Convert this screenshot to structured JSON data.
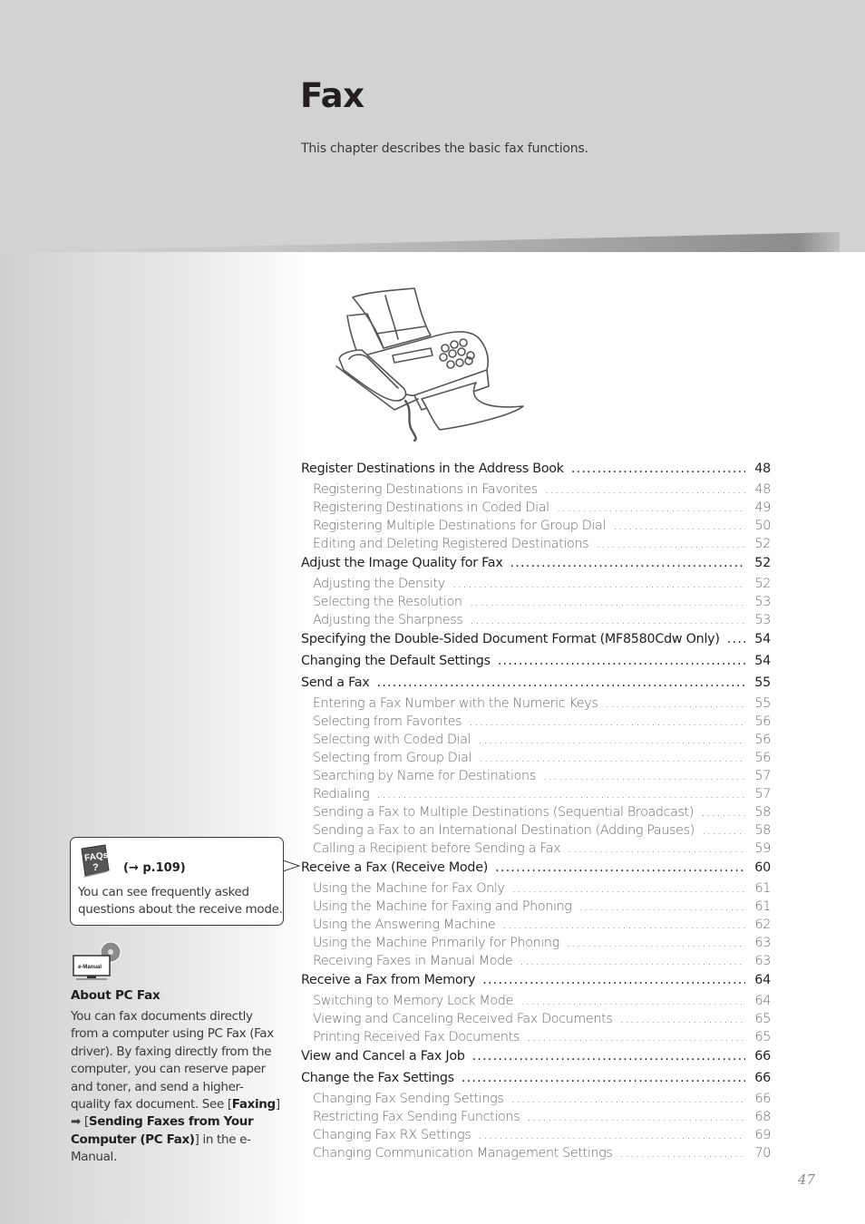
{
  "header": {
    "title": "Fax",
    "subtitle": "This chapter describes the basic fax functions."
  },
  "illustration": {
    "icon": "fax-machine-illustration"
  },
  "toc": [
    {
      "level": "main",
      "label": "Register Destinations in the Address Book",
      "page": "48"
    },
    {
      "level": "sub",
      "label": "Registering Destinations in Favorites",
      "page": "48"
    },
    {
      "level": "sub",
      "label": "Registering Destinations in Coded Dial",
      "page": "49"
    },
    {
      "level": "sub",
      "label": "Registering Multiple Destinations for Group Dial",
      "page": "50"
    },
    {
      "level": "sub",
      "label": "Editing and Deleting Registered Destinations",
      "page": "52"
    },
    {
      "level": "main",
      "label": "Adjust the Image Quality for Fax",
      "page": "52"
    },
    {
      "level": "sub",
      "label": "Adjusting the Density",
      "page": "52"
    },
    {
      "level": "sub",
      "label": "Selecting the Resolution",
      "page": "53"
    },
    {
      "level": "sub",
      "label": "Adjusting the Sharpness",
      "page": "53"
    },
    {
      "level": "main",
      "label": "Specifying the Double-Sided Document Format (MF8580Cdw Only)",
      "page": "54"
    },
    {
      "level": "main",
      "label": "Changing the Default Settings",
      "page": "54"
    },
    {
      "level": "main",
      "label": "Send a Fax",
      "page": "55"
    },
    {
      "level": "sub",
      "label": "Entering a Fax Number with the Numeric Keys",
      "page": "55"
    },
    {
      "level": "sub",
      "label": "Selecting from Favorites",
      "page": "56"
    },
    {
      "level": "sub",
      "label": "Selecting with Coded Dial",
      "page": "56"
    },
    {
      "level": "sub",
      "label": "Selecting from Group Dial",
      "page": "56"
    },
    {
      "level": "sub",
      "label": "Searching by Name for Destinations",
      "page": "57"
    },
    {
      "level": "sub",
      "label": "Redialing",
      "page": "57"
    },
    {
      "level": "sub",
      "label": "Sending a Fax to Multiple Destinations (Sequential Broadcast)",
      "page": "58"
    },
    {
      "level": "sub",
      "label": "Sending a Fax to an International Destination (Adding Pauses)",
      "page": "58"
    },
    {
      "level": "sub",
      "label": "Calling a Recipient before Sending a Fax",
      "page": "59"
    },
    {
      "level": "main",
      "label": "Receive a Fax (Receive Mode)",
      "page": "60"
    },
    {
      "level": "sub",
      "label": "Using the Machine for Fax Only",
      "page": "61"
    },
    {
      "level": "sub",
      "label": "Using the Machine for Faxing and Phoning",
      "page": "61"
    },
    {
      "level": "sub",
      "label": "Using the Answering Machine",
      "page": "62"
    },
    {
      "level": "sub",
      "label": "Using the Machine Primarily for Phoning",
      "page": "63"
    },
    {
      "level": "sub",
      "label": "Receiving Faxes in Manual Mode",
      "page": "63"
    },
    {
      "level": "main",
      "label": "Receive a Fax from Memory",
      "page": "64"
    },
    {
      "level": "sub",
      "label": "Switching to Memory Lock Mode",
      "page": "64"
    },
    {
      "level": "sub",
      "label": "Viewing and Canceling Received Fax Documents",
      "page": "65"
    },
    {
      "level": "sub",
      "label": "Printing Received Fax Documents",
      "page": "65"
    },
    {
      "level": "main",
      "label": "View and Cancel a Fax Job",
      "page": "66"
    },
    {
      "level": "main",
      "label": "Change the Fax Settings",
      "page": "66"
    },
    {
      "level": "sub",
      "label": "Changing Fax Sending Settings",
      "page": "66"
    },
    {
      "level": "sub",
      "label": "Restricting Fax Sending Functions",
      "page": "68"
    },
    {
      "level": "sub",
      "label": "Changing Fax RX Settings",
      "page": "69"
    },
    {
      "level": "sub",
      "label": "Changing Communication Management Settings",
      "page": "70"
    }
  ],
  "faq": {
    "icon_label_top": "FAQs",
    "icon_label_bottom": "?",
    "link": "(→ p.109)",
    "text": "You can see frequently asked questions about the receive mode."
  },
  "about_pc_fax": {
    "icon_label": "e-Manual",
    "title": "About PC Fax",
    "text_before": "You can fax documents directly from a computer using PC Fax (Fax driver). By faxing directly from the computer, you can reserve paper and toner, and send a higher-quality fax document. See [",
    "link1": "Faxing",
    "arrow": "] ➡ [",
    "link2": "Sending Faxes from Your Computer (PC Fax)",
    "text_after": "] in the e-Manual."
  },
  "page_number": "47",
  "colors": {
    "header_bg": "#d2d2d2",
    "main_text": "#231f20",
    "sub_text": "#6b6b6b",
    "page_number": "#8a8a8a"
  }
}
